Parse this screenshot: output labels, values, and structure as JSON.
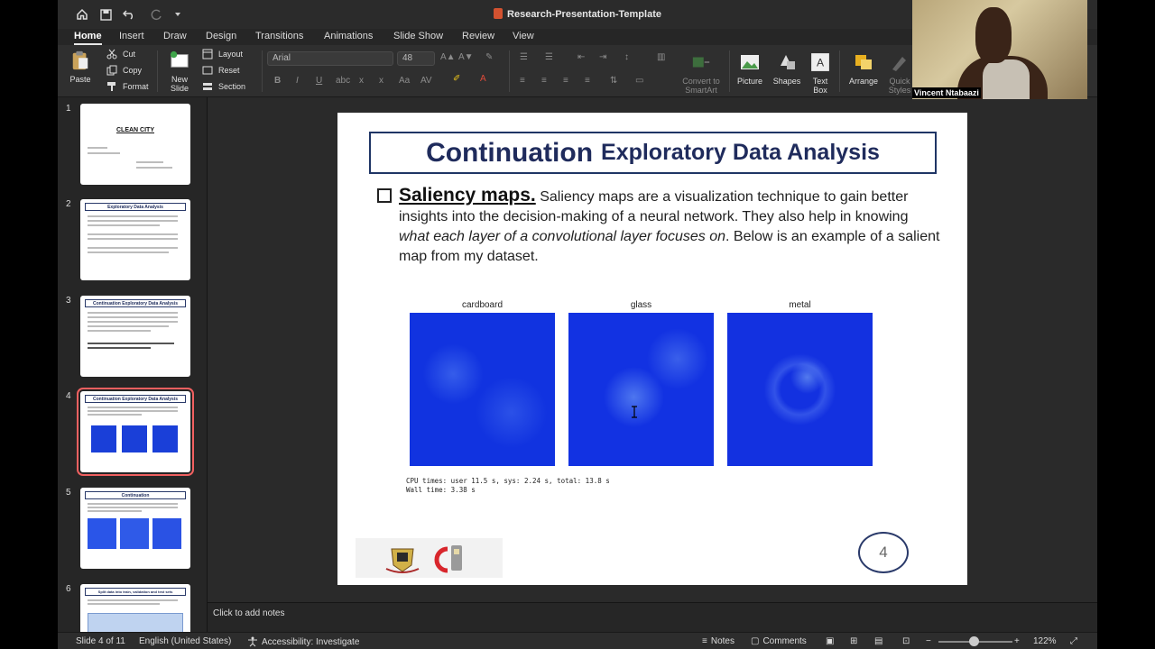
{
  "window": {
    "title": "Research-Presentation-Template"
  },
  "ribbon": {
    "tabs": [
      "Home",
      "Insert",
      "Draw",
      "Design",
      "Transitions",
      "Animations",
      "Slide Show",
      "Review",
      "View"
    ],
    "active_tab": "Home",
    "paste": "Paste",
    "cut": "Cut",
    "copy": "Copy",
    "format": "Format",
    "new_slide": "New Slide",
    "layout": "Layout",
    "reset": "Reset",
    "section": "Section",
    "font_name": "Arial",
    "font_size": "48",
    "convert_smartart": "Convert to SmartArt",
    "picture": "Picture",
    "shapes": "Shapes",
    "text_box": "Text Box",
    "arrange": "Arrange",
    "quick_styles": "Quick Styles"
  },
  "thumbnails": [
    {
      "num": "1",
      "title": "CLEAN CITY"
    },
    {
      "num": "2",
      "title": "Exploratory Data Analysis"
    },
    {
      "num": "3",
      "title": "Continuation Exploratory Data Analysis"
    },
    {
      "num": "4",
      "title": "Continuation Exploratory Data Analysis"
    },
    {
      "num": "5",
      "title": "Continuation"
    },
    {
      "num": "6",
      "title": "Split data into train, validation and test sets"
    }
  ],
  "slide": {
    "title_main": "Continuation",
    "title_sub": "Exploratory Data Analysis",
    "lead": "Saliency maps.",
    "body_1": " Saliency maps are a visualization technique to gain better insights into the decision-making of a neural network. They also help in knowing ",
    "body_italic": "what each layer of a convolutional layer focuses on",
    "body_2": ". Below is an example of a salient map from my dataset.",
    "images": [
      "cardboard",
      "glass",
      "metal"
    ],
    "code_line_1": "CPU times: user 11.5 s, sys: 2.24 s, total: 13.8 s",
    "code_line_2": "Wall time: 3.38 s",
    "page_number": "4"
  },
  "notes": {
    "placeholder": "Click to add notes"
  },
  "status": {
    "slide_info": "Slide 4 of 11",
    "language": "English (United States)",
    "accessibility": "Accessibility: Investigate",
    "notes": "Notes",
    "comments": "Comments",
    "zoom": "122%"
  },
  "webcam": {
    "name": "Vincent Ntabaazi"
  }
}
